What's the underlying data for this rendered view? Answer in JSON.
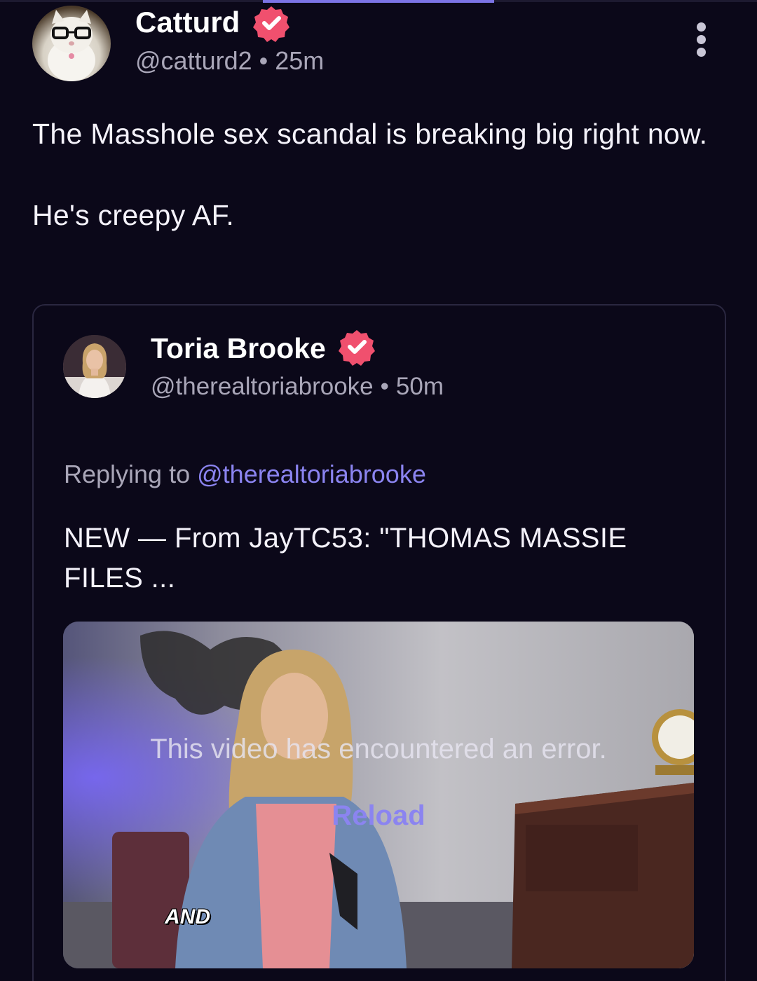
{
  "post": {
    "author_name": "Catturd",
    "handle": "@catturd2",
    "separator": "•",
    "time": "25m",
    "text_line1": "The Masshole sex scandal is breaking big right now.",
    "text_line2": "He's creepy AF."
  },
  "quoted_post": {
    "author_name": "Toria Brooke",
    "handle": "@therealtoriabrooke",
    "separator": "•",
    "time": "50m",
    "replying_label": "Replying to",
    "replying_handle": "@therealtoriabrooke",
    "text": "NEW — From JayTC53: \"THOMAS MASSIE FILES ..."
  },
  "video": {
    "error_message": "This video has encountered an error.",
    "reload_label": "Reload",
    "caption": "AND"
  },
  "colors": {
    "background": "#0b0819",
    "accent": "#8b84f0",
    "verified_badge": "#f0506e",
    "muted_text": "#a9a6b8"
  },
  "icons": {
    "verified": "verified-badge-icon",
    "more": "more-vertical-icon"
  }
}
